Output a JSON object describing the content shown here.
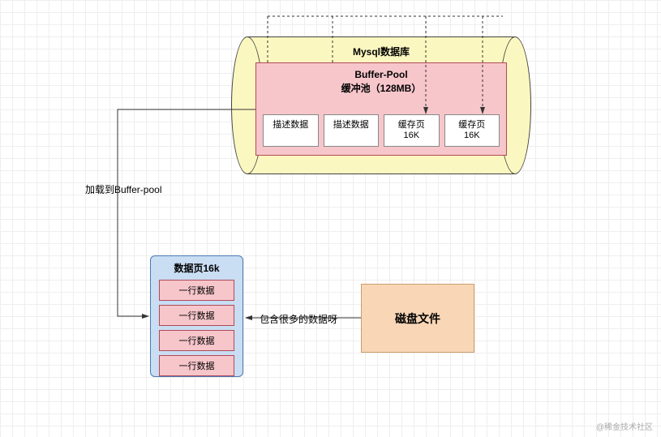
{
  "database": {
    "title": "Mysql数据库",
    "buffer_pool": {
      "title_line1": "Buffer-Pool",
      "title_line2": "缓冲池（128MB）",
      "items": [
        {
          "label": "描述数据"
        },
        {
          "label": "描述数据"
        },
        {
          "line1": "缓存页",
          "line2": "16K"
        },
        {
          "line1": "缓存页",
          "line2": "16K"
        }
      ]
    }
  },
  "labels": {
    "load_to_buffer": "加载到Buffer-pool",
    "contains_many_pages": "包含很多的数据呀"
  },
  "data_page": {
    "title": "数据页16k",
    "rows": [
      "一行数据",
      "一行数据",
      "一行数据",
      "一行数据"
    ]
  },
  "disk_file": {
    "label": "磁盘文件"
  },
  "watermark": "@稀金技术社区"
}
